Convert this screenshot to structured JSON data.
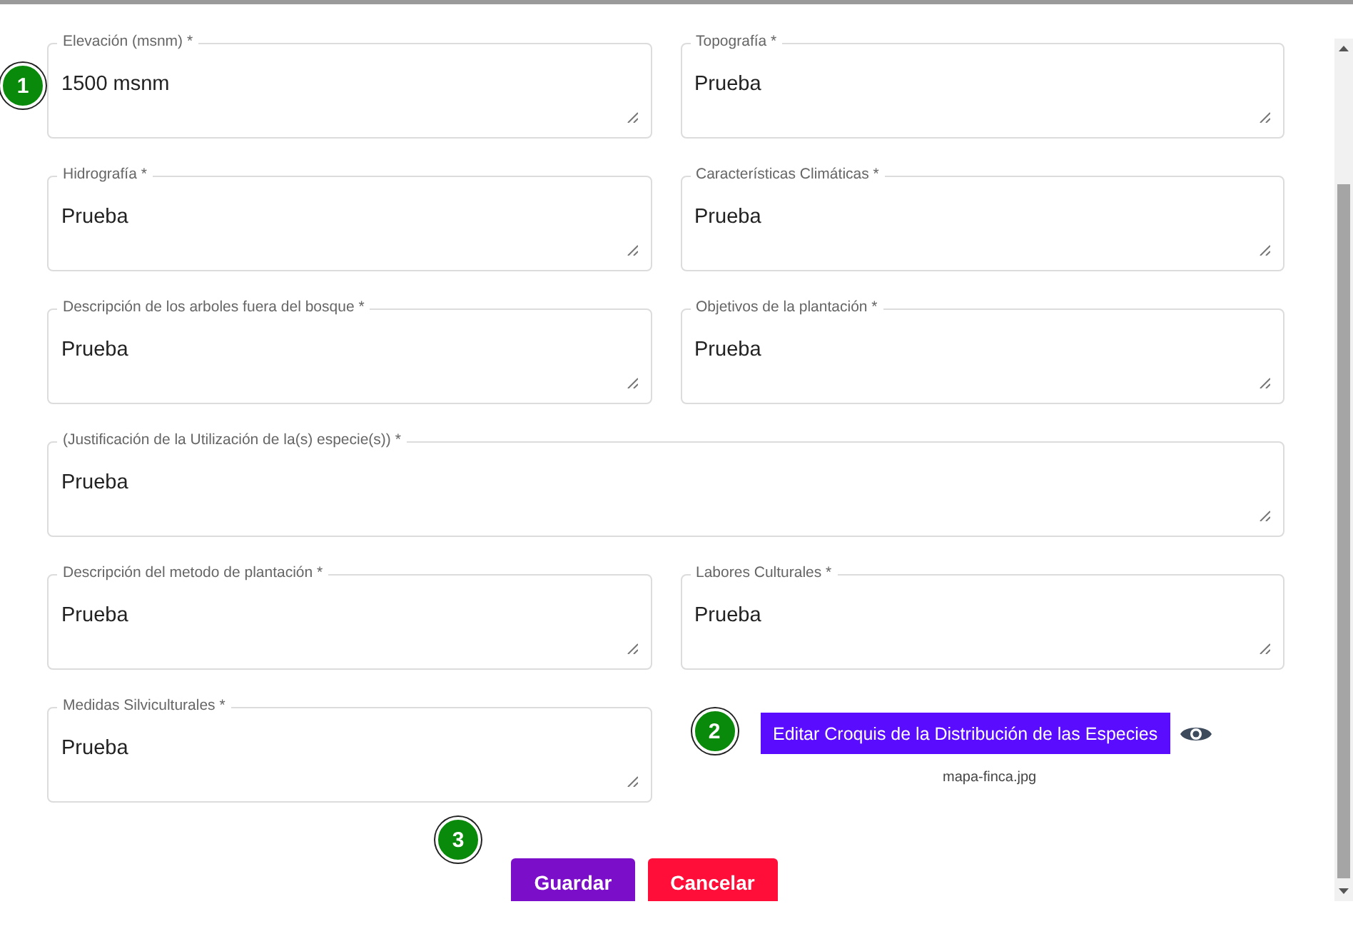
{
  "rows": [
    {
      "fields": [
        {
          "label": "Elevación (msnm) *",
          "value": "1500 msnm",
          "marker": "1"
        },
        {
          "label": "Topografía *",
          "value": "Prueba"
        }
      ]
    },
    {
      "fields": [
        {
          "label": "Hidrografía *",
          "value": "Prueba"
        },
        {
          "label": "Características Climáticas *",
          "value": "Prueba"
        }
      ]
    },
    {
      "fields": [
        {
          "label": "Descripción de los arboles fuera del bosque *",
          "value": "Prueba"
        },
        {
          "label": "Objetivos de la plantación *",
          "value": "Prueba"
        }
      ]
    },
    {
      "fields": [
        {
          "label": "(Justificación de la Utilización de la(s) especie(s)) *",
          "value": "Prueba"
        }
      ]
    },
    {
      "fields": [
        {
          "label": "Descripción del metodo de plantación *",
          "value": "Prueba"
        },
        {
          "label": "Labores Culturales *",
          "value": "Prueba"
        }
      ]
    },
    {
      "fields": [
        {
          "label": "Medidas Silviculturales *",
          "value": "Prueba"
        }
      ],
      "sketch": {
        "button": "Editar Croquis de la Distribución de las Especies",
        "file": "mapa-finca.jpg",
        "marker": "2"
      }
    }
  ],
  "actions": {
    "marker": "3",
    "buttons": [
      {
        "label": "Guardar",
        "kind": "primary"
      },
      {
        "label": "Cancelar",
        "kind": "danger"
      }
    ]
  }
}
